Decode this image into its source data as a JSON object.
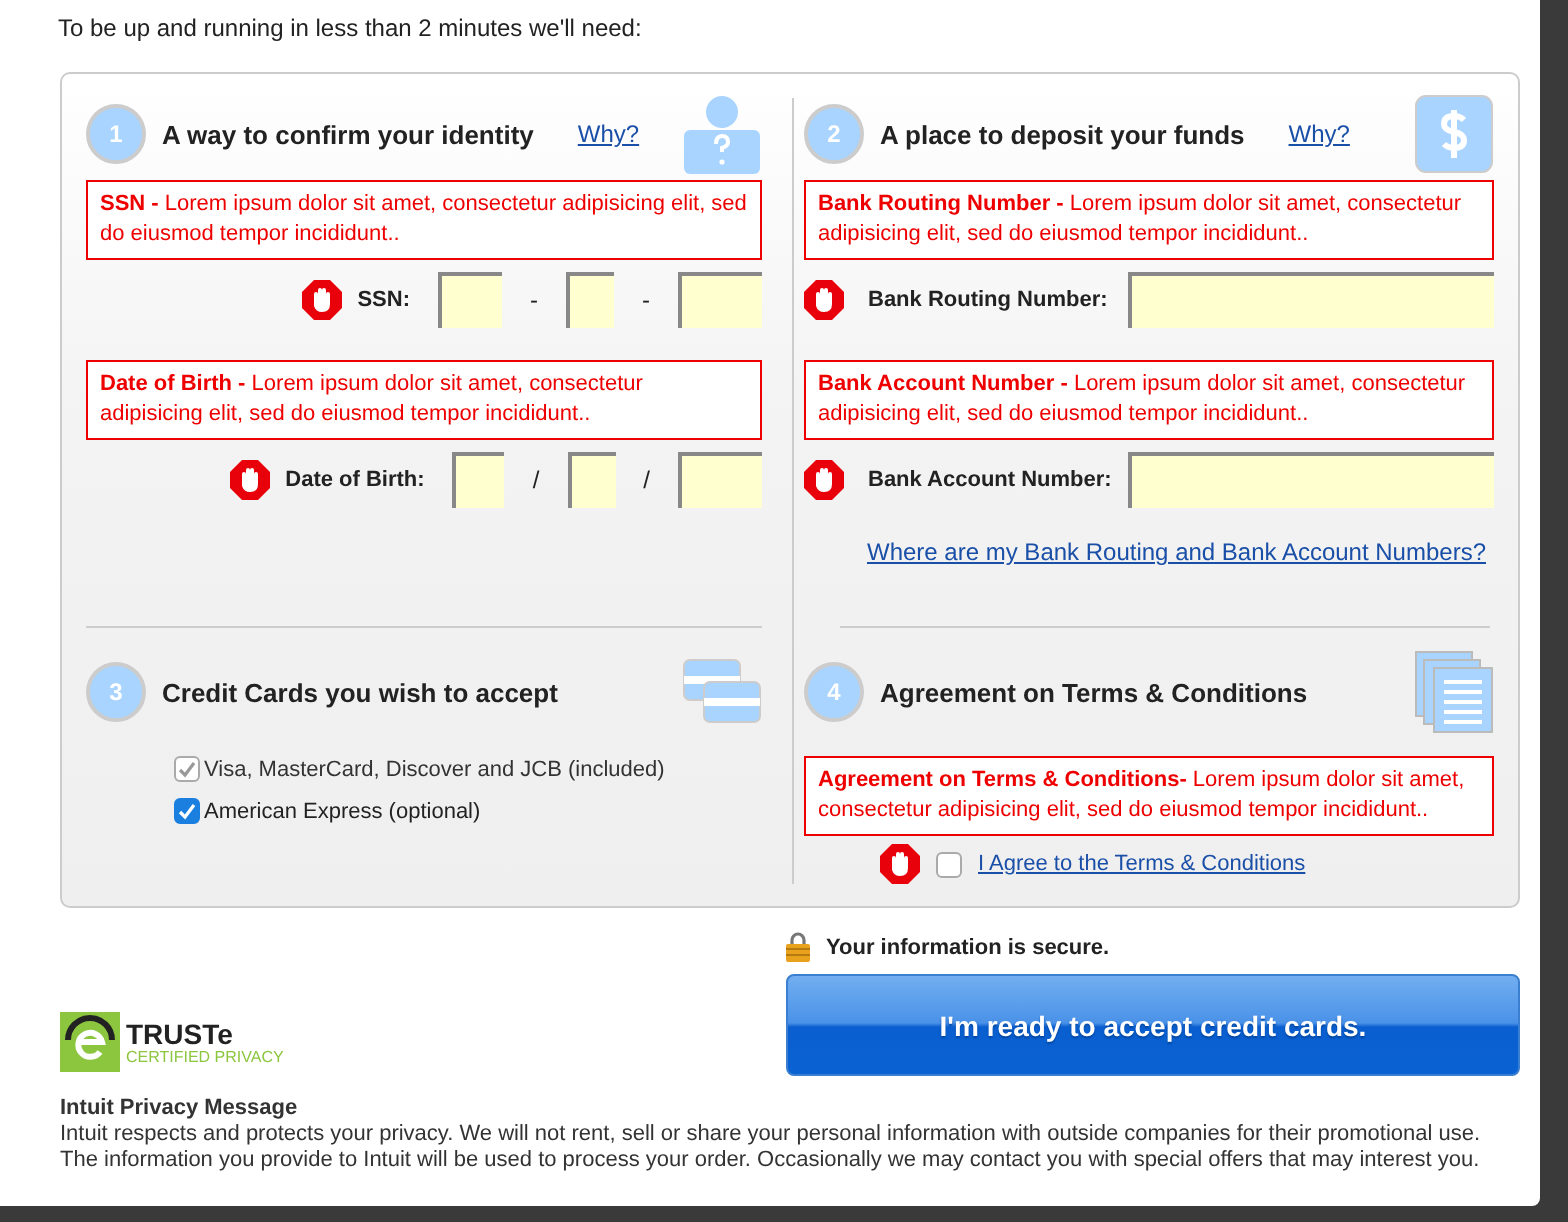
{
  "intro": "To be up and running in less than 2 minutes we'll need:",
  "identity": {
    "number": "1",
    "title": "A way to confirm your identity",
    "why": "Why?",
    "fields": [
      {
        "error": "**SSN -** Lorem ipsum dolor sit amet, consectetur adipisicing elit, sed do eiusmod tempor incididunt..",
        "label": "SSN:",
        "kind": "split",
        "separator": "-"
      },
      {
        "error": "**Date of Birth -** Lorem ipsum dolor sit amet, consectetur adipisicing elit, sed do eiusmod tempor incididunt..",
        "label": "Date of Birth:",
        "kind": "split",
        "separator": "/"
      }
    ]
  },
  "deposit": {
    "number": "2",
    "title": "A place to deposit your funds",
    "why": "Why?",
    "fields": [
      {
        "error": "**Bank Routing Number -** Lorem ipsum dolor sit amet, consectetur adipisicing elit, sed do eiusmod tempor incididunt..",
        "label": "Bank Routing Number:",
        "kind": "single"
      },
      {
        "error": "**Bank Account Number -** Lorem ipsum dolor sit amet, consectetur adipisicing elit, sed do eiusmod tempor incididunt..",
        "label": "Bank Account Number:",
        "kind": "single"
      }
    ],
    "help_link": "Where are my Bank Routing and Bank Account Numbers?"
  },
  "cards": {
    "number": "3",
    "title": "Credit Cards you wish to accept",
    "options": [
      {
        "label": "Visa, MasterCard, Discover and JCB (included)",
        "checked": true,
        "disabled": true
      },
      {
        "label": "American Express (optional)",
        "checked": true,
        "disabled": false
      }
    ]
  },
  "terms": {
    "number": "4",
    "title": "Agreement on Terms & Conditions",
    "error": "**Agreement on Terms & Conditions-** Lorem ipsum dolor sit amet, consectetur adipisicing elit, sed do eiusmod tempor incididunt..",
    "agree": {
      "label": "I Agree to the Terms & Conditions",
      "checked": false
    }
  },
  "secure": "Your information is secure.",
  "submit": "I'm ready to accept credit cards.",
  "truste": {
    "name": "TRUSTe",
    "tagline": "CERTIFIED PRIVACY"
  },
  "privacy": {
    "title": "Intuit Privacy Message",
    "lines": [
      "Intuit respects and protects your privacy. We will not rent, sell or share your personal information with outside companies for their promotional use.",
      "The information you provide to Intuit will be used to process your order. Occasionally we may contact you with special offers that may interest you."
    ]
  }
}
